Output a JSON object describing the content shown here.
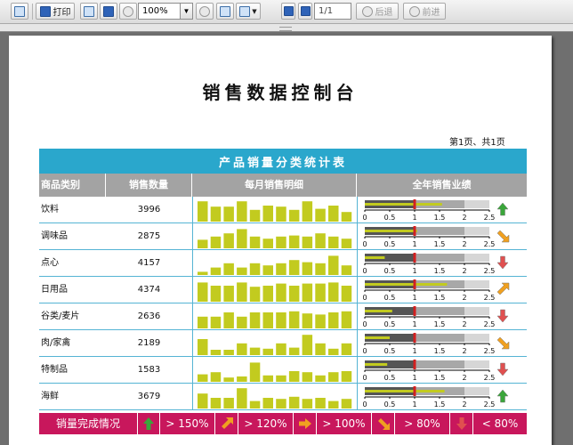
{
  "toolbar": {
    "print_label": "打印",
    "find_label": "...",
    "zoom_value": "100%",
    "page_value": "1/1",
    "back_label": "后退",
    "forward_label": "前进"
  },
  "report": {
    "title": "销售数据控制台",
    "page_info": "第1页、共1页",
    "table_title": "产品销量分类统计表",
    "headers": [
      "商品类别",
      "销售数量",
      "每月销售明细",
      "全年销售业绩"
    ],
    "axis_ticks": [
      "0",
      "0.5",
      "1",
      "1.5",
      "2",
      "2.5"
    ]
  },
  "chart_data": {
    "type": "table",
    "title": "产品销量分类统计表",
    "columns": [
      "商品类别",
      "销售数量",
      "每月销售明细",
      "全年销售业绩"
    ],
    "rows": [
      {
        "category": "饮料",
        "quantity": "3996",
        "monthly": [
          0.95,
          0.7,
          0.7,
          0.95,
          0.55,
          0.75,
          0.7,
          0.55,
          0.95,
          0.6,
          0.75,
          0.45
        ],
        "performance": 1.55,
        "trend": "up"
      },
      {
        "category": "调味品",
        "quantity": "2875",
        "monthly": [
          0.4,
          0.55,
          0.7,
          0.9,
          0.55,
          0.45,
          0.55,
          0.6,
          0.55,
          0.7,
          0.55,
          0.45
        ],
        "performance": 1.05,
        "trend": "down-right"
      },
      {
        "category": "点心",
        "quantity": "4157",
        "monthly": [
          0.15,
          0.35,
          0.55,
          0.35,
          0.55,
          0.45,
          0.55,
          0.7,
          0.6,
          0.55,
          0.9,
          0.45
        ],
        "performance": 0.4,
        "trend": "down"
      },
      {
        "category": "日用品",
        "quantity": "4374",
        "monthly": [
          0.9,
          0.75,
          0.75,
          0.9,
          0.7,
          0.75,
          0.85,
          0.75,
          0.85,
          0.85,
          0.9,
          0.75
        ],
        "performance": 1.65,
        "trend": "up-right"
      },
      {
        "category": "谷类/麦片",
        "quantity": "2636",
        "monthly": [
          0.55,
          0.55,
          0.75,
          0.55,
          0.75,
          0.75,
          0.75,
          0.8,
          0.7,
          0.65,
          0.75,
          0.8
        ],
        "performance": 0.55,
        "trend": "down"
      },
      {
        "category": "肉/家禽",
        "quantity": "2189",
        "monthly": [
          0.75,
          0.25,
          0.25,
          0.55,
          0.35,
          0.3,
          0.55,
          0.35,
          0.95,
          0.55,
          0.3,
          0.55
        ],
        "performance": 0.5,
        "trend": "down-right"
      },
      {
        "category": "特制品",
        "quantity": "1583",
        "monthly": [
          0.35,
          0.45,
          0.2,
          0.25,
          0.9,
          0.3,
          0.3,
          0.5,
          0.45,
          0.3,
          0.45,
          0.5
        ],
        "performance": 0.45,
        "trend": "down"
      },
      {
        "category": "海鲜",
        "quantity": "3679",
        "monthly": [
          0.7,
          0.5,
          0.5,
          0.95,
          0.35,
          0.5,
          0.45,
          0.55,
          0.45,
          0.5,
          0.35,
          0.45
        ],
        "performance": 1.6,
        "trend": "up"
      }
    ],
    "axis_range": [
      0,
      2.5
    ],
    "target": 1
  },
  "legend": {
    "title": "销量完成情况",
    "items": [
      "> 150%",
      "> 120%",
      "> 100%",
      "> 80%",
      "< 80%"
    ]
  },
  "colors": {
    "header_blue": "#2aa7cc",
    "legend_red": "#c8175c",
    "spark_bar": "#c2cb1f",
    "bullet_bar": "#c2cb1f",
    "target_mark": "#d32020",
    "arrow_up": "#3aa63a",
    "arrow_diag": "#f0a020",
    "arrow_down": "#e05050"
  }
}
